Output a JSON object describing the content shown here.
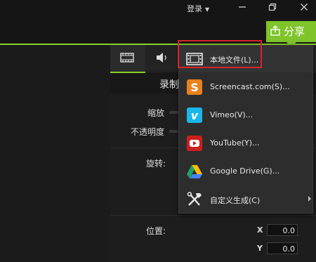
{
  "titlebar": {
    "login_label": "登录",
    "minimize_icon": "minimize-icon",
    "restore_icon": "restore-icon",
    "close_icon": "close-icon"
  },
  "share": {
    "label": "分享",
    "icon": "share-upload-icon",
    "accent": "#7ec42a"
  },
  "tabs": [
    {
      "name": "video-tab",
      "icon": "film-icon",
      "active": true
    },
    {
      "name": "audio-tab",
      "icon": "speaker-icon",
      "active": false
    }
  ],
  "properties": {
    "section_title": "录制",
    "scale_label": "缩放",
    "opacity_label": "不透明度",
    "rotation_label": "旋转:",
    "position_label": "位置:",
    "x_label": "X",
    "y_label": "Y",
    "x_value": "0.0",
    "y_value": "0.0"
  },
  "share_menu": {
    "items": [
      {
        "label": "本地文件(L)...",
        "icon": "film-strip-icon",
        "highlighted": true
      },
      {
        "label": "Screencast.com(S)...",
        "icon": "screencast-icon",
        "color": "#e8821e"
      },
      {
        "label": "Vimeo(V)...",
        "icon": "vimeo-icon",
        "color": "#1ab7ea"
      },
      {
        "label": "YouTube(Y)...",
        "icon": "youtube-icon",
        "color": "#cc1f1f"
      },
      {
        "label": "Google Drive(G)...",
        "icon": "google-drive-icon"
      },
      {
        "label": "自定义生成(C)",
        "icon": "tools-icon",
        "has_submenu": true
      }
    ],
    "highlight_color": "#d7232a"
  }
}
